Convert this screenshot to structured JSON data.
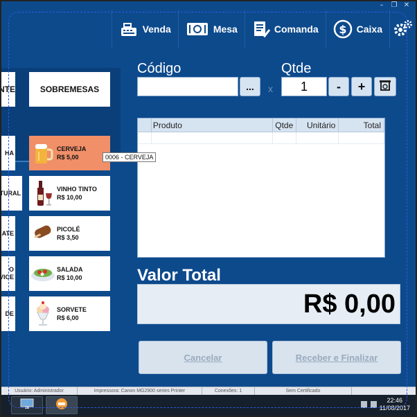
{
  "nav": [
    {
      "label": "Venda",
      "icon": "cash-register-icon"
    },
    {
      "label": "Mesa",
      "icon": "dining-plate-icon"
    },
    {
      "label": "Comanda",
      "icon": "checklist-icon"
    },
    {
      "label": "Caixa",
      "icon": "dollar-coin-icon"
    }
  ],
  "settings_icon": "gears-icon",
  "categories": [
    {
      "label": "NTE"
    },
    {
      "label": "SOBREMESAS"
    }
  ],
  "left_column": [
    "HA",
    "TURAL",
    "ATE",
    "O\nVICE",
    "DE"
  ],
  "products": [
    {
      "name": "CERVEJA",
      "price": "R$ 5,00",
      "icon": "beer-mug-icon",
      "selected": true
    },
    {
      "name": "VINHO TINTO",
      "price": "R$ 10,00",
      "icon": "wine-bottle-icon",
      "selected": false
    },
    {
      "name": "PICOLÉ",
      "price": "R$ 3,50",
      "icon": "popsicle-icon",
      "selected": false
    },
    {
      "name": "SALADA",
      "price": "R$ 10,00",
      "icon": "salad-icon",
      "selected": false
    },
    {
      "name": "SORVETE",
      "price": "R$ 6,00",
      "icon": "ice-cream-icon",
      "selected": false
    }
  ],
  "tooltip": "0006 - CERVEJA",
  "order": {
    "code_label": "Código",
    "code_value": "",
    "browse_label": "...",
    "times": "x",
    "qty_label": "Qtde",
    "qty_value": "1",
    "minus": "-",
    "plus": "+",
    "columns": [
      "",
      "Produto",
      "Qtde",
      "Unitário",
      "Total"
    ],
    "total_label": "Valor Total",
    "total_value": "R$ 0,00",
    "cancel_label": "Cancelar",
    "finish_label": "Receber e Finalizar"
  },
  "status": {
    "user": "Usuário: Administrador",
    "printer": "Impressora: Canon MG2900 series Printer",
    "connections": "Conexões: 1",
    "certificate": "Sem Certificado"
  },
  "taskbar": {
    "time": "22:46",
    "date": "11/08/2017"
  },
  "colors": {
    "background": "#0d4a8c",
    "selected_product": "#f08f68",
    "dashed_outline": "#2f57e3"
  }
}
